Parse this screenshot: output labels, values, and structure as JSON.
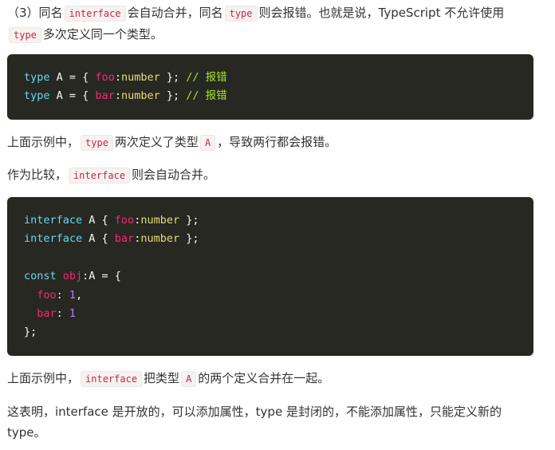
{
  "para1": {
    "t1": "（3）同名",
    "c1": "interface",
    "t2": "会自动合并，同名",
    "c2": "type",
    "t3": "则会报错。也就是说，TypeScript 不允许使用",
    "c3": "type",
    "t4": "多次定义同一个类型。"
  },
  "code1": {
    "lines": [
      {
        "kw": "type",
        "rest1": " A = { ",
        "prop": "foo",
        "colon": ":",
        "type": "number",
        "rest2": " }; ",
        "comment": "// 报错"
      },
      {
        "kw": "type",
        "rest1": " A = { ",
        "prop": "bar",
        "colon": ":",
        "type": "number",
        "rest2": " }; ",
        "comment": "// 报错"
      }
    ]
  },
  "para2": {
    "t1": "上面示例中，",
    "c1": "type",
    "t2": "两次定义了类型",
    "c2": "A",
    "t3": "，导致两行都会报错。"
  },
  "para3": {
    "t1": "作为比较，",
    "c1": "interface",
    "t2": "则会自动合并。"
  },
  "code2": {
    "l1": {
      "kw": "interface",
      "rest1": " A { ",
      "prop": "foo",
      "colon": ":",
      "type": "number",
      "rest2": " };"
    },
    "l2": {
      "kw": "interface",
      "rest1": " A { ",
      "prop": "bar",
      "colon": ":",
      "type": "number",
      "rest2": " };"
    },
    "l4": {
      "kw": "const",
      "sp": " ",
      "name": "obj",
      "rest": ":A = {"
    },
    "l5": {
      "indent": "  ",
      "prop": "foo",
      "sep": ": ",
      "num": "1",
      "end": ","
    },
    "l6": {
      "indent": "  ",
      "prop": "bar",
      "sep": ": ",
      "num": "1",
      "end": ""
    },
    "l7": "};"
  },
  "para4": {
    "t1": "上面示例中，",
    "c1": "interface",
    "t2": "把类型",
    "c2": "A",
    "t3": "的两个定义合并在一起。"
  },
  "para5": {
    "t1": "这表明，interface 是开放的，可以添加属性，type 是封闭的，不能添加属性，只能定义新的 type。"
  },
  "colors": {
    "code_bg": "#272822",
    "inline_code_fg": "#c7254e",
    "keyword": "#66d9ef",
    "property": "#f92672",
    "number": "#ae81ff",
    "comment": "#a6e22e",
    "text": "#333333"
  }
}
